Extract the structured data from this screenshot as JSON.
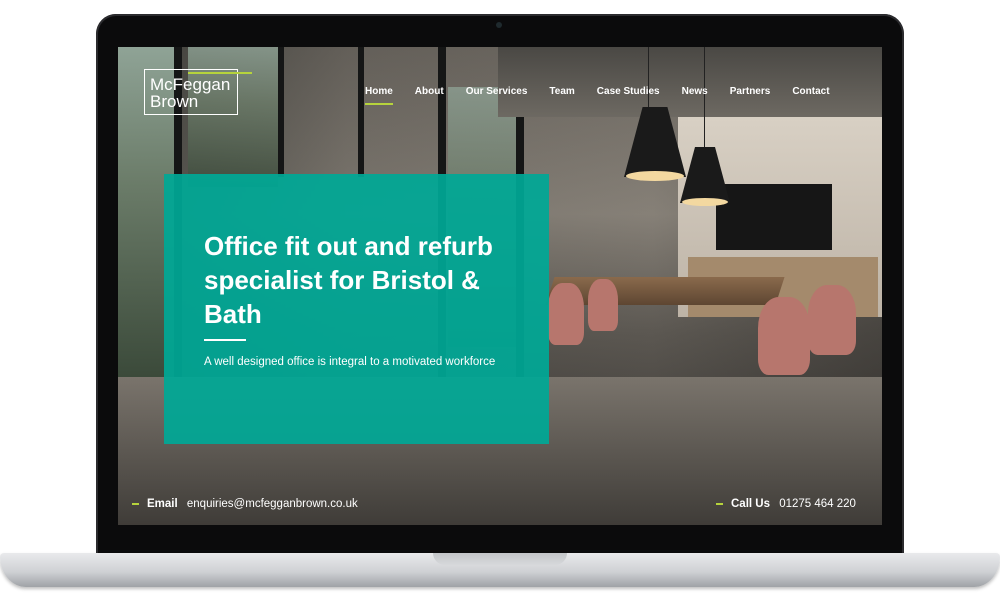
{
  "brand": {
    "logo_line1": "McFeggan",
    "logo_line2": "Brown"
  },
  "nav": {
    "items": [
      {
        "label": "Home",
        "active": true
      },
      {
        "label": "About",
        "active": false
      },
      {
        "label": "Our Services",
        "active": false
      },
      {
        "label": "Team",
        "active": false
      },
      {
        "label": "Case Studies",
        "active": false
      },
      {
        "label": "News",
        "active": false
      },
      {
        "label": "Partners",
        "active": false
      },
      {
        "label": "Contact",
        "active": false
      }
    ]
  },
  "hero": {
    "title": "Office fit out and refurb specialist for Bristol & Bath",
    "subtitle": "A well designed office is integral to a motivated workforce"
  },
  "contact": {
    "email_label": "Email",
    "email_value": "enquiries@mcfegganbrown.co.uk",
    "phone_label": "Call Us",
    "phone_value": "01275 464 220"
  },
  "colors": {
    "accent": "#b6d33c",
    "hero_panel": "#00a896"
  }
}
